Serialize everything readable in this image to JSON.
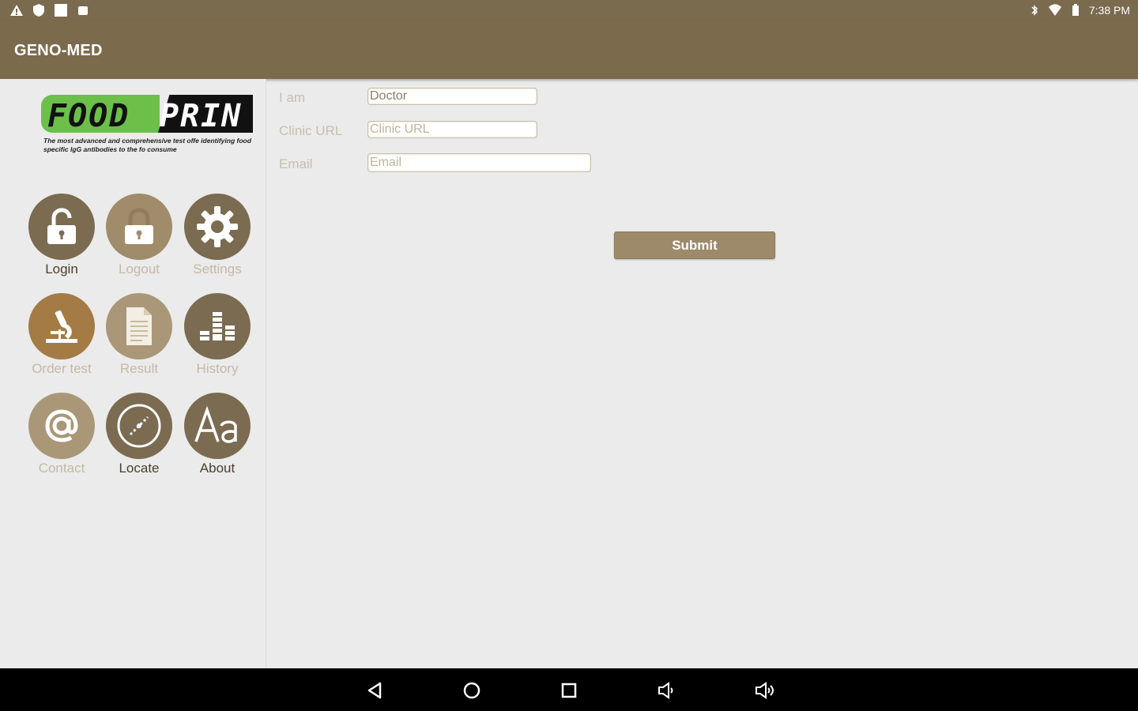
{
  "status_bar": {
    "time": "7:38 PM"
  },
  "app_bar": {
    "title": "GENO-MED"
  },
  "logo": {
    "brand_part1": "FOOD",
    "brand_part2": "PRIN",
    "tagline": "The most advanced and comprehensive test offe identifying food specific IgG antibodies to the fo consume"
  },
  "menu": {
    "login": "Login",
    "logout": "Logout",
    "settings": "Settings",
    "order_test": "Order test",
    "result": "Result",
    "history": "History",
    "contact": "Contact",
    "locate": "Locate",
    "about": "About"
  },
  "form": {
    "iam_label": "I am",
    "iam_value": "Doctor",
    "clinic_label": "Clinic URL",
    "clinic_placeholder": "Clinic URL",
    "email_label": "Email",
    "email_placeholder": "Email",
    "submit_label": "Submit"
  },
  "colors": {
    "app_bar": "#7c6a4d",
    "accent": "#9c8a6b"
  }
}
